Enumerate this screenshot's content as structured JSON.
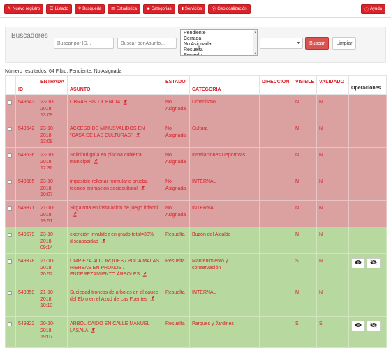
{
  "navbar": {
    "buttons": [
      {
        "label": "Nuevo registro",
        "icon": "pencil-icon"
      },
      {
        "label": "Listado",
        "icon": "list-icon"
      },
      {
        "label": "Busqueda",
        "icon": "search-icon"
      },
      {
        "label": "Estadistica",
        "icon": "bar-chart-icon"
      },
      {
        "label": "Categorias",
        "icon": "tags-icon"
      },
      {
        "label": "Servicios",
        "icon": "bookmark-icon"
      },
      {
        "label": "Geolocalización",
        "icon": "map-marker-icon"
      }
    ],
    "help_label": "Ayuda"
  },
  "search": {
    "title": "Buscadores",
    "id_placeholder": "Buscar por ID...",
    "asunto_placeholder": "Buscar por Asunto...",
    "estado_options": [
      "Pendiente",
      "Cerrada",
      "No Asignada",
      "Resuelta",
      "Remedo"
    ],
    "buscar_label": "Buscar",
    "limpiar_label": "Limpiar"
  },
  "results_info": "Número resultados: 64 Filtro: Pendiente, No Asignada",
  "table": {
    "headers": {
      "id": "ID",
      "entrada": "ENTRADA",
      "asunto": "ASUNTO",
      "estado": "ESTADO",
      "categoria": "CATEGORIA",
      "direccion": "DIRECCION",
      "visible": "VISIBLE",
      "validado": "VALIDADO",
      "operaciones": "Operaciones"
    },
    "rows": [
      {
        "id": "549643",
        "entrada": [
          "23-10-",
          "2018",
          "13:09"
        ],
        "asunto": "OBRAS SIN LICENCIA",
        "estado": "No Asignada",
        "categoria": "Urbanismo",
        "direccion": "",
        "visible": "N",
        "validado": "N",
        "color": "red",
        "ops": false
      },
      {
        "id": "549642",
        "entrada": [
          "23-10-",
          "2018",
          "13:08"
        ],
        "asunto": "ACCESO DE MINUSVALIDOS EN \"CASA DE LAS CULTURAS\"",
        "estado": "No Asignada",
        "categoria": "Cultura",
        "direccion": "",
        "visible": "N",
        "validado": "N",
        "color": "red",
        "ops": false
      },
      {
        "id": "549636",
        "entrada": [
          "23-10-",
          "2018",
          "12:30"
        ],
        "asunto": "Solicitud grúa en piscina cubierta municipal",
        "estado": "No Asignada",
        "categoria": "Instalaciones Deportivas",
        "direccion": "",
        "visible": "N",
        "validado": "N",
        "color": "red",
        "ops": false
      },
      {
        "id": "549605",
        "entrada": [
          "23-10-",
          "2018",
          "10:07"
        ],
        "asunto": "imposible rellenar formulario prueba tecnico animación sociocultural",
        "estado": "No Asignada",
        "categoria": "INTERNAL",
        "direccion": "",
        "visible": "N",
        "validado": "N",
        "color": "red",
        "ops": false
      },
      {
        "id": "549371",
        "entrada": [
          "21-10-",
          "2018",
          "19:51"
        ],
        "asunto": "Sirga rota en instalacion de juego infantil",
        "estado": "No Asignada",
        "categoria": "INTERNAL",
        "direccion": "",
        "visible": "N",
        "validado": "N",
        "color": "red",
        "ops": false
      },
      {
        "id": "549579",
        "entrada": [
          "23-10-",
          "2018",
          "09:14"
        ],
        "asunto": "exención invalidez en grado total=33% discapacidad",
        "estado": "Resuelta",
        "categoria": "Buzón del Alcalde",
        "direccion": "",
        "visible": "N",
        "validado": "N",
        "color": "green",
        "ops": false
      },
      {
        "id": "549378",
        "entrada": [
          "21-10-",
          "2018",
          "20:52"
        ],
        "asunto": "LIMPIEZA ALCORQUES / PODA MALAS HIERBAS EN PRUNOS / ENDEREZAMIENTO ÁRBOLES",
        "estado": "Resuelta",
        "categoria": "Mantenimiento y conservación",
        "direccion": "",
        "visible": "S",
        "validado": "N",
        "color": "green",
        "ops": true
      },
      {
        "id": "549359",
        "entrada": [
          "21-10-",
          "2018",
          "18:13"
        ],
        "asunto": "Suciedad troncos de arboles en el cauce del Ebro en el Azud de Las Fuentes",
        "estado": "Resuelta",
        "categoria": "INTERNAL",
        "direccion": "",
        "visible": "N",
        "validado": "N",
        "color": "green",
        "ops": false
      },
      {
        "id": "549322",
        "entrada": [
          "20-10-",
          "2018",
          "19:07"
        ],
        "asunto": "ARBOL CAIDO EN CALLE MANUEL LASALA",
        "estado": "Resuelta",
        "categoria": "Parques y Jardines",
        "direccion": "",
        "visible": "S",
        "validado": "S",
        "color": "green",
        "ops": true
      }
    ]
  },
  "colors": {
    "accent": "#d9222a",
    "row_pending": "#dba0a0",
    "row_resolved": "#b7d99f"
  }
}
